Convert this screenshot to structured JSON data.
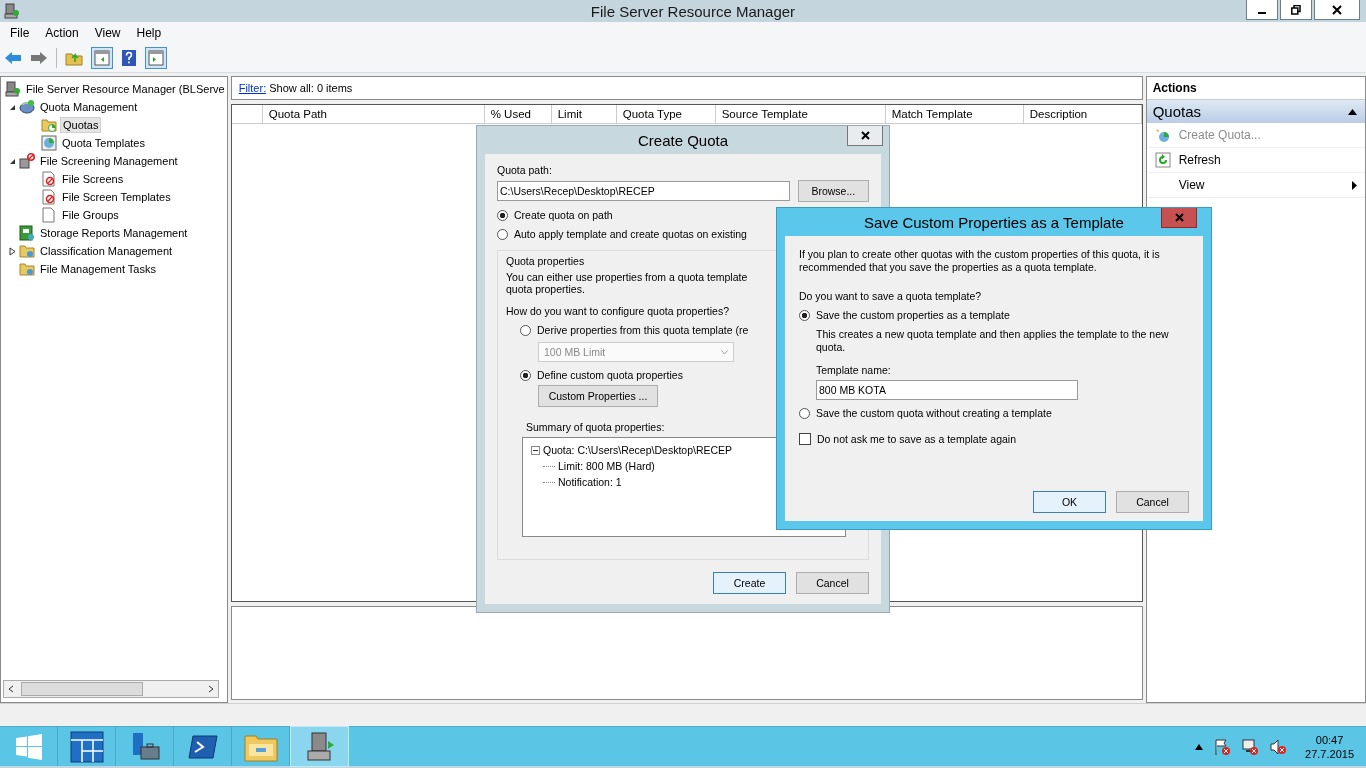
{
  "window": {
    "title": "File Server Resource Manager"
  },
  "menu": [
    "File",
    "Action",
    "View",
    "Help"
  ],
  "tree": [
    {
      "label": "File Server Resource Manager (BLServe",
      "kind": "server",
      "selected": false,
      "children": [
        {
          "label": "Quota Management",
          "kind": "quota-mgmt",
          "selected": false,
          "expanded": true,
          "children": [
            {
              "label": "Quotas",
              "kind": "folder",
              "selected": true
            },
            {
              "label": "Quota Templates",
              "kind": "template",
              "selected": false
            }
          ]
        },
        {
          "label": "File Screening Management",
          "kind": "screening",
          "selected": false,
          "expanded": true,
          "children": [
            {
              "label": "File Screens",
              "kind": "screen",
              "selected": false
            },
            {
              "label": "File Screen Templates",
              "kind": "screen-template",
              "selected": false
            },
            {
              "label": "File Groups",
              "kind": "file",
              "selected": false
            }
          ]
        },
        {
          "label": "Storage Reports Management",
          "kind": "reports",
          "selected": false
        },
        {
          "label": "Classification Management",
          "kind": "classification",
          "selected": false,
          "expanded": false
        },
        {
          "label": "File Management Tasks",
          "kind": "tasks",
          "selected": false
        }
      ]
    }
  ],
  "filter": {
    "link": "Filter:",
    "text": "Show all: 0 items"
  },
  "table": {
    "columns": [
      "Quota Path",
      "% Used",
      "Limit",
      "Quota Type",
      "Source Template",
      "Match Template",
      "Description"
    ]
  },
  "actions": {
    "header": "Actions",
    "section": "Quotas",
    "items": [
      {
        "label": "Create Quota...",
        "kind": "create",
        "disabled": true
      },
      {
        "label": "Refresh",
        "kind": "refresh",
        "disabled": false
      },
      {
        "label": "View",
        "kind": "submenu",
        "disabled": false
      }
    ]
  },
  "create_quota": {
    "title": "Create Quota",
    "path_label": "Quota path:",
    "path": "C:\\Users\\Recep\\Desktop\\RECEP",
    "browse": "Browse...",
    "options": [
      {
        "label": "Create quota on path",
        "selected": true
      },
      {
        "label": "Auto apply template and create quotas on existing",
        "selected": false
      }
    ],
    "group_title": "Quota properties",
    "description": [
      "You can either use properties from a quota template",
      "quota properties."
    ],
    "question": "How do you want to configure quota properties?",
    "derive": {
      "label": "Derive properties from this quota template (re",
      "selected": false
    },
    "template_select": {
      "value": "100 MB Limit",
      "disabled": true
    },
    "custom": {
      "label": "Define custom quota properties",
      "selected": true
    },
    "custom_button": "Custom Properties ...",
    "summary_label": "Summary of quota properties:",
    "summary": {
      "label": "Quota: C:\\Users\\Recep\\Desktop\\RECEP",
      "expanded": true,
      "children": [
        "Limit: 800 MB (Hard)",
        "Notification: 1"
      ]
    },
    "buttons": [
      {
        "label": "Create",
        "default": true
      },
      {
        "label": "Cancel",
        "default": false
      }
    ]
  },
  "save_template": {
    "title": "Save Custom Properties as a Template",
    "intro": "If you plan to create other quotas with the custom properties of this quota, it is recommended that you save the properties as a quota template.",
    "question": "Do you want to save a quota template?",
    "options": [
      {
        "label": "Save the custom properties as a template",
        "selected": true,
        "note": "This creates a new quota template and then applies the template to the new quota.",
        "field_label": "Template name:",
        "field_value": "800 MB KOTA"
      },
      {
        "label": "Save the custom quota without creating a template",
        "selected": false
      }
    ],
    "checkbox": {
      "label": "Do not ask me to save as a template again",
      "checked": false
    },
    "buttons": [
      {
        "label": "OK",
        "default": true
      },
      {
        "label": "Cancel",
        "default": false
      }
    ]
  },
  "taskbar": {
    "time": "00:47",
    "date": "27.7.2015"
  }
}
